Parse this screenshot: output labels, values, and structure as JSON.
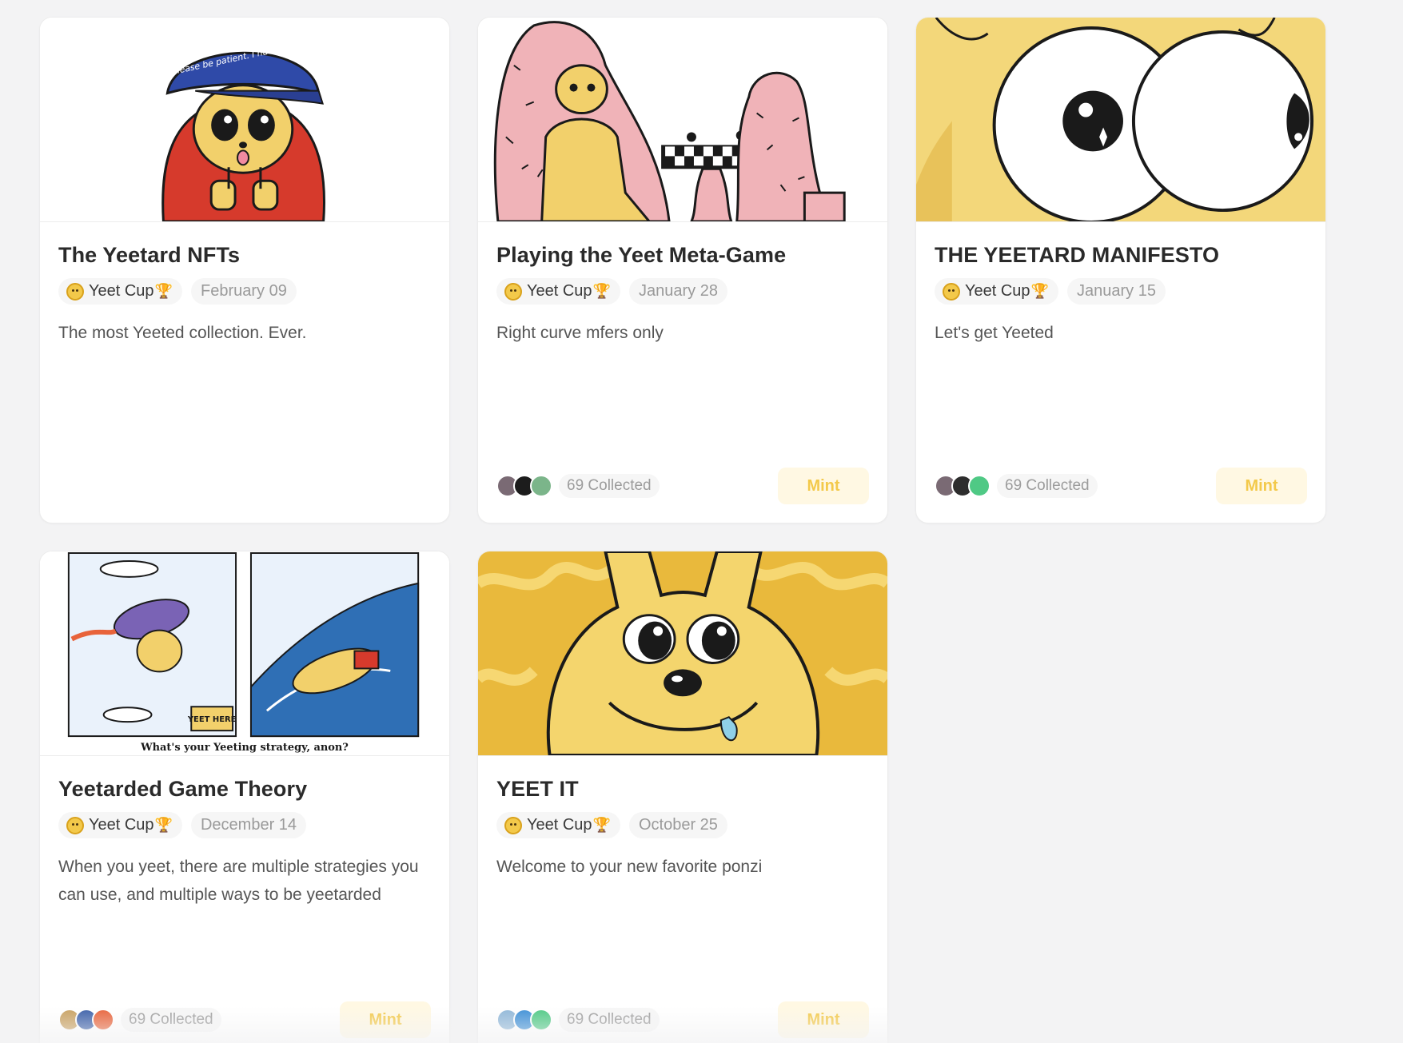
{
  "cards": [
    {
      "title": "The Yeetard NFTs",
      "creator": "Yeet Cup",
      "creator_icon": "yeet-cup-coin-icon",
      "trophy": "🏆",
      "date": "February 09",
      "description": "The most Yeeted collection. Ever.",
      "hat_text": "Please be patient. I have yeetism.",
      "has_footer": false
    },
    {
      "title": "Playing the Yeet Meta-Game",
      "creator": "Yeet Cup",
      "creator_icon": "yeet-cup-coin-icon",
      "trophy": "🏆",
      "date": "January 28",
      "description": "Right curve mfers only",
      "has_footer": true,
      "collected": "69 Collected",
      "mint": "Mint",
      "avatar_colors": [
        "#7a6a74",
        "#1c1c1c",
        "#7bb58a"
      ]
    },
    {
      "title": "THE YEETARD MANIFESTO",
      "creator": "Yeet Cup",
      "creator_icon": "yeet-cup-coin-icon",
      "trophy": "🏆",
      "date": "January 15",
      "description": "Let's get Yeeted",
      "has_footer": true,
      "collected": "69 Collected",
      "mint": "Mint",
      "avatar_colors": [
        "#7a6a74",
        "#2d2d2d",
        "#4fc985"
      ]
    },
    {
      "title": "Yeetarded Game Theory",
      "creator": "Yeet Cup",
      "creator_icon": "yeet-cup-coin-icon",
      "trophy": "🏆",
      "date": "December 14",
      "description": "When you yeet, there are multiple strategies you can use, and multiple ways to be yeetarded",
      "caption": "What's your Yeeting strategy, anon?",
      "sign_text": "YEET HERE",
      "has_footer": true,
      "collected": "69 Collected",
      "mint": "Mint",
      "avatar_colors": [
        "#c8a060",
        "#3b5fa8",
        "#e8633a"
      ]
    },
    {
      "title": "YEET IT",
      "creator": "Yeet Cup",
      "creator_icon": "yeet-cup-coin-icon",
      "trophy": "🏆",
      "date": "October 25",
      "description": "Welcome to your new favorite ponzi",
      "has_footer": true,
      "collected": "69 Collected",
      "mint": "Mint",
      "avatar_colors": [
        "#8fb7d8",
        "#3d8fd6",
        "#4fc985"
      ]
    }
  ],
  "colors": {
    "accent": "#f3c94a",
    "mint_bg": "#fff8e3",
    "page_bg": "#f3f3f4",
    "card_bg": "#ffffff"
  }
}
